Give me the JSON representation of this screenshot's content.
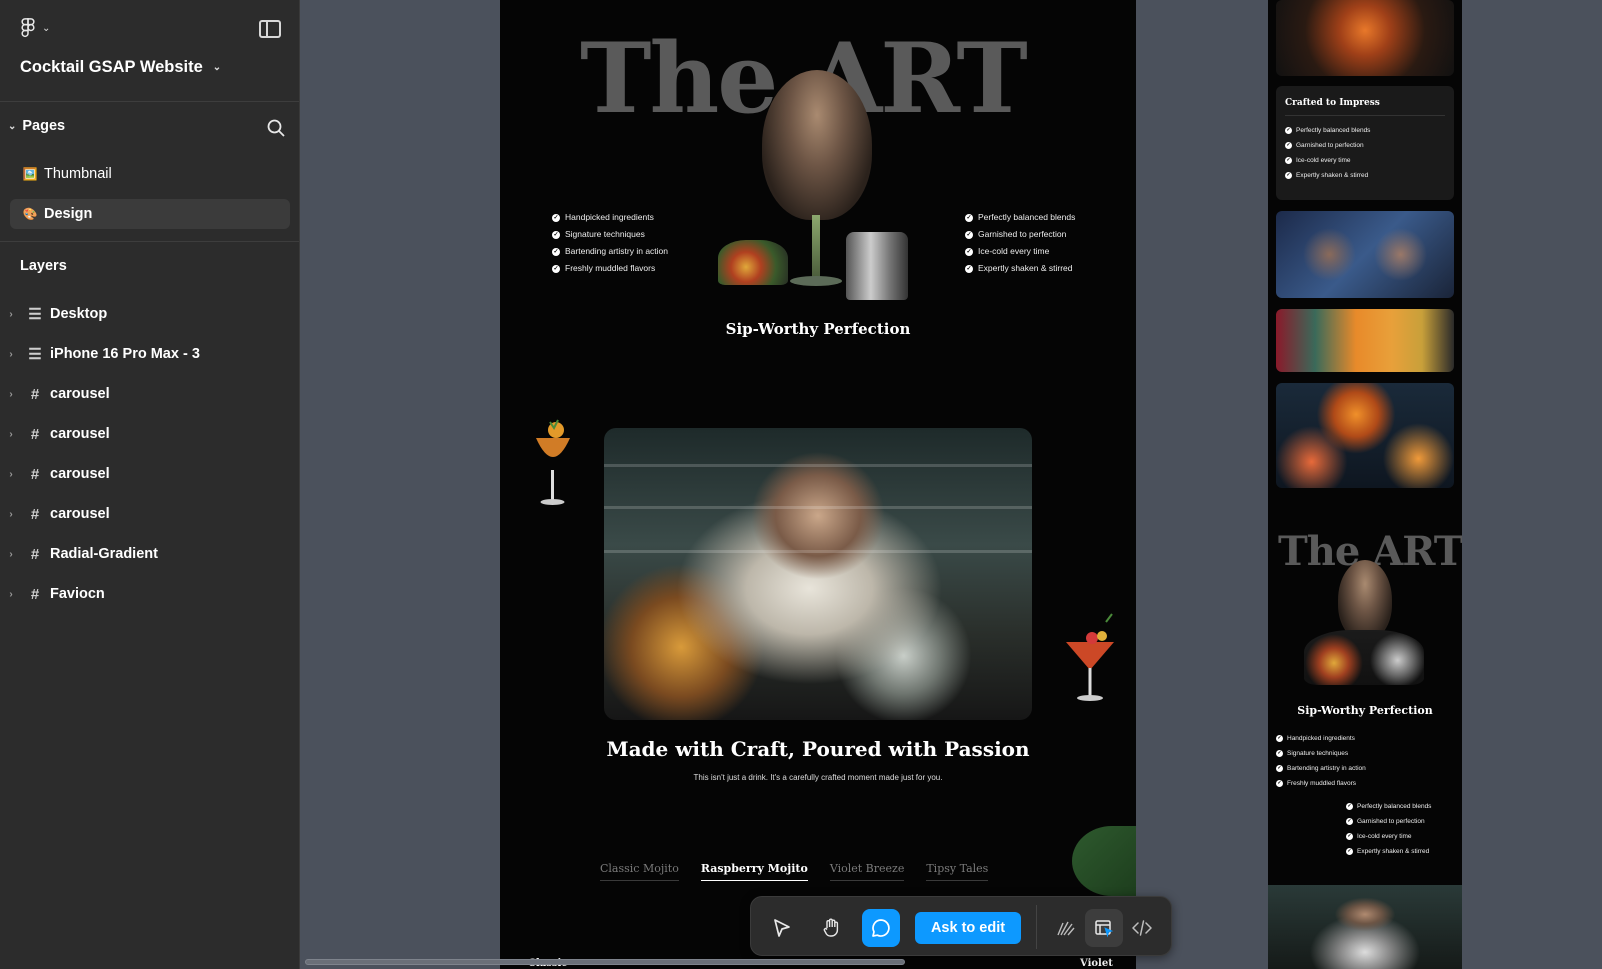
{
  "sidebar": {
    "file_title": "Cocktail GSAP Website",
    "pages_label": "Pages",
    "pages": [
      {
        "emoji": "🖼️",
        "label": "Thumbnail"
      },
      {
        "emoji": "🎨",
        "label": "Design"
      }
    ],
    "layers_label": "Layers",
    "layers": [
      {
        "icon": "frame-icon",
        "label": "Desktop"
      },
      {
        "icon": "frame-icon",
        "label": "iPhone 16 Pro Max - 3"
      },
      {
        "icon": "grid-icon",
        "label": "carousel"
      },
      {
        "icon": "grid-icon",
        "label": "carousel"
      },
      {
        "icon": "grid-icon",
        "label": "carousel"
      },
      {
        "icon": "grid-icon",
        "label": "carousel"
      },
      {
        "icon": "grid-icon",
        "label": "Radial-Gradient"
      },
      {
        "icon": "grid-icon",
        "label": "Faviocn"
      }
    ]
  },
  "desktop": {
    "art_title": "The ART",
    "features_left": [
      "Handpicked ingredients",
      "Signature techniques",
      "Bartending artistry in action",
      "Freshly muddled flavors"
    ],
    "features_right": [
      "Perfectly balanced blends",
      "Garnished to perfection",
      "Ice-cold every time",
      "Expertly shaken & stirred"
    ],
    "sip_heading": "Sip-Worthy Perfection",
    "craft_heading": "Made with Craft, Poured with Passion",
    "craft_sub": "This isn't just a drink. It's a carefully crafted moment made just for you.",
    "tabs": [
      "Classic Mojito",
      "Raspberry Mojito",
      "Violet Breeze",
      "Tipsy Tales"
    ],
    "active_tab": "Raspberry Mojito",
    "bottom_left": "Classic",
    "bottom_right": "Violet"
  },
  "mobile": {
    "card_title": "Crafted to Impress",
    "card_items": [
      "Perfectly balanced blends",
      "Garnished to perfection",
      "Ice-cold every time",
      "Expertly shaken & stirred"
    ],
    "art_title": "The ART",
    "sip_heading": "Sip-Worthy Perfection",
    "list_left": [
      "Handpicked ingredients",
      "Signature techniques",
      "Bartending artistry in action",
      "Freshly muddled flavors"
    ],
    "list_right": [
      "Perfectly balanced blends",
      "Garnished to perfection",
      "Ice-cold every time",
      "Expertly shaken & stirred"
    ]
  },
  "toolbar": {
    "ask_label": "Ask to edit",
    "accent": "#0d99ff"
  }
}
